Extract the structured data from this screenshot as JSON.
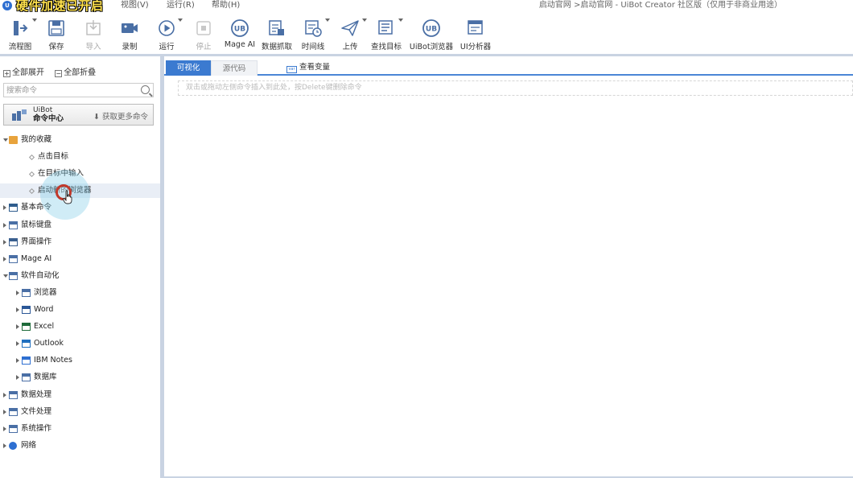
{
  "titlebar": {
    "logo_letter": "U",
    "banner": "硬件加速已开启",
    "menus": [
      "视图(V)",
      "运行(R)",
      "帮助(H)"
    ],
    "breadcrumb": "启动官网 >启动官网 - UiBot Creator 社区版（仅用于非商业用途）"
  },
  "toolbar": {
    "items": [
      {
        "label": "流程图",
        "icon": "flowchart-icon",
        "disabled": false
      },
      {
        "label": "保存",
        "icon": "save-icon",
        "disabled": false
      },
      {
        "label": "导入",
        "icon": "import-icon",
        "disabled": true
      },
      {
        "label": "录制",
        "icon": "record-icon",
        "disabled": false
      },
      {
        "label": "运行",
        "icon": "run-icon",
        "disabled": false
      },
      {
        "label": "停止",
        "icon": "stop-icon",
        "disabled": true
      },
      {
        "label": "Mage AI",
        "icon": "mage-ai-icon",
        "disabled": false
      },
      {
        "label": "数据抓取",
        "icon": "data-scrape-icon",
        "disabled": false
      },
      {
        "label": "时间线",
        "icon": "timeline-icon",
        "disabled": false
      },
      {
        "label": "上传",
        "icon": "upload-icon",
        "disabled": false
      },
      {
        "label": "查找目标",
        "icon": "find-target-icon",
        "disabled": false
      },
      {
        "label": "UiBot浏览器",
        "icon": "uibot-browser-icon",
        "disabled": false
      },
      {
        "label": "UI分析器",
        "icon": "ui-analyzer-icon",
        "disabled": false
      }
    ]
  },
  "left_panel": {
    "expand_all": "全部展开",
    "collapse_all": "全部折叠",
    "search_placeholder": "搜索命令",
    "command_center": {
      "title": "UiBot",
      "subtitle": "命令中心",
      "more": "获取更多命令"
    },
    "tree": [
      {
        "label": "我的收藏",
        "icon": "folder-icon",
        "level": 0,
        "state": "expanded"
      },
      {
        "label": "点击目标",
        "level": 1,
        "state": "leaf"
      },
      {
        "label": "在目标中输入",
        "level": 1,
        "state": "leaf"
      },
      {
        "label": "启动新的浏览器",
        "level": 1,
        "state": "leaf",
        "hovered": true
      },
      {
        "label": "基本命令",
        "icon": "terminal-icon",
        "level": 0,
        "state": "collapsed"
      },
      {
        "label": "鼠标键盘",
        "icon": "keyboard-icon",
        "level": 0,
        "state": "collapsed"
      },
      {
        "label": "界面操作",
        "icon": "window-icon",
        "level": 0,
        "state": "collapsed"
      },
      {
        "label": "Mage AI",
        "icon": "mage-ai-icon",
        "level": 0,
        "state": "collapsed"
      },
      {
        "label": "软件自动化",
        "icon": "gear-icon",
        "level": 0,
        "state": "expanded"
      },
      {
        "label": "浏览器",
        "icon": "browser-icon",
        "level": 1,
        "state": "collapsed"
      },
      {
        "label": "Word",
        "icon": "word-icon",
        "level": 1,
        "state": "collapsed"
      },
      {
        "label": "Excel",
        "icon": "excel-icon",
        "level": 1,
        "state": "collapsed"
      },
      {
        "label": "Outlook",
        "icon": "outlook-icon",
        "level": 1,
        "state": "collapsed"
      },
      {
        "label": "IBM Notes",
        "icon": "ibm-notes-icon",
        "level": 1,
        "state": "collapsed"
      },
      {
        "label": "数据库",
        "icon": "database-icon",
        "level": 1,
        "state": "collapsed"
      },
      {
        "label": "数据处理",
        "icon": "data-processing-icon",
        "level": 0,
        "state": "collapsed"
      },
      {
        "label": "文件处理",
        "icon": "file-icon",
        "level": 0,
        "state": "collapsed"
      },
      {
        "label": "系统操作",
        "icon": "system-icon",
        "level": 0,
        "state": "collapsed"
      },
      {
        "label": "网络",
        "icon": "network-icon",
        "level": 0,
        "state": "collapsed"
      }
    ]
  },
  "editor": {
    "tabs": [
      {
        "label": "可视化",
        "active": true
      },
      {
        "label": "源代码",
        "active": false
      }
    ],
    "view_variables": "查看变量",
    "drop_hint": "双击或拖动左侧命令插入到此处，按Delete键删除命令"
  },
  "colors": {
    "accent": "#3b7ad0",
    "banner": "#ffe14d",
    "splitter": "#c9d3e2"
  }
}
